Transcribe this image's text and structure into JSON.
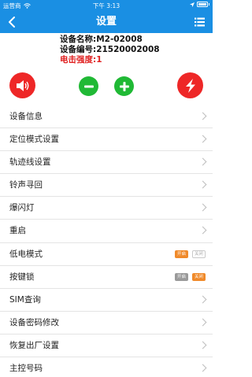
{
  "status_bar": {
    "carrier": "运营商",
    "time": "下午 3:13"
  },
  "nav": {
    "title": "设置",
    "back_icon": "back-chevron-icon",
    "menu_icon": "list-menu-icon"
  },
  "device": {
    "name_line": "设备名称:M2-02008",
    "id_line": "设备编号:21520002008",
    "signal_line": "电击强度:1"
  },
  "controls": {
    "sound_icon": "speaker-icon",
    "minus_icon": "minus-icon",
    "plus_icon": "plus-icon",
    "shock_icon": "lightning-icon"
  },
  "menu": {
    "device_info": "设备信息",
    "location_mode": "定位模式设置",
    "track_settings": "轨迹线设置",
    "ring_find": "铃声寻回",
    "flash_light": "爆闪灯",
    "restart": "重启",
    "low_power": "低电模式",
    "low_power_on": "开启",
    "low_power_off": "关闭",
    "key_lock": "按键锁",
    "key_lock_on": "开启",
    "key_lock_off": "关闭",
    "sim_query": "SIM查询",
    "password_change": "设备密码修改",
    "factory_reset": "恢复出厂设置",
    "master_number": "主控号码"
  },
  "colors": {
    "brand_blue": "#1a8fe3",
    "red": "#ee2727",
    "green": "#20b935",
    "orange": "#f08a2a"
  }
}
